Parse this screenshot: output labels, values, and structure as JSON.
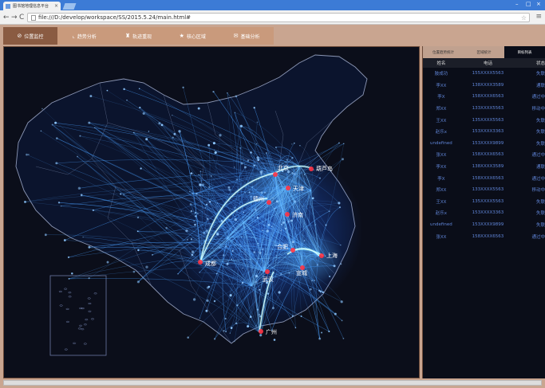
{
  "browser": {
    "tab_title": "图书馆地理信息平台",
    "url": "file:///D:/develop/workspace/SS/2015.5.24/main.html#"
  },
  "nav": [
    {
      "label": "位置监控",
      "icon": "⊘",
      "active": true
    },
    {
      "label": "趋势分析",
      "icon": "⌞",
      "active": false
    },
    {
      "label": "轨迹重现",
      "icon": "♜",
      "active": false
    },
    {
      "label": "核心区域",
      "icon": "★",
      "active": false
    },
    {
      "label": "基础分析",
      "icon": "✉",
      "active": false
    }
  ],
  "panel": {
    "tabs": [
      {
        "label": "位置趋势统计",
        "active": false
      },
      {
        "label": "区域统计",
        "active": false
      },
      {
        "label": "目标列表",
        "active": true
      }
    ],
    "columns": [
      "姓名",
      "电话",
      "状态"
    ],
    "rows": [
      [
        "肢成功",
        "155XXXX5563",
        "失联"
      ],
      [
        "李XX",
        "138XXXX3589",
        "通联"
      ],
      [
        "李X",
        "158XXXX6563",
        "通过中"
      ],
      [
        "郑XX",
        "133XXXX5563",
        "移动中"
      ],
      [
        "王XX",
        "135XXXX5563",
        "失联"
      ],
      [
        "赵乐x",
        "153XXXX3363",
        "失联"
      ],
      [
        "undefined",
        "153XXXX9899",
        "失联"
      ],
      [
        "张XX",
        "158XXXX6563",
        "通过中"
      ],
      [
        "李XX",
        "138XXXX3589",
        "通联"
      ],
      [
        "李X",
        "158XXXX6563",
        "通过中"
      ],
      [
        "郑XX",
        "133XXXX5563",
        "移动中"
      ],
      [
        "王XX",
        "135XXXX5563",
        "失联"
      ],
      [
        "赵乐x",
        "153XXXX3363",
        "失联"
      ],
      [
        "undefined",
        "153XXXX9899",
        "失联"
      ],
      [
        "张XX",
        "158XXXX6563",
        "通过中"
      ]
    ]
  },
  "map": {
    "cities": [
      "北京",
      "天津",
      "葫芦岛",
      "德州",
      "济南",
      "合肥",
      "上海",
      "宣城",
      "成都",
      "武汉",
      "广州"
    ]
  },
  "colors": {
    "flow": "#4aa0ff",
    "hot": "#dfffff",
    "city_dot": "#ff3344"
  }
}
